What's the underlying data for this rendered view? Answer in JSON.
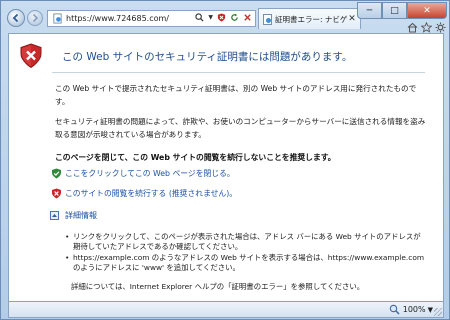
{
  "window": {
    "controls": {
      "minimize": "─",
      "maximize": "□",
      "close": "✕"
    }
  },
  "toolbar": {
    "back_icon": "back-arrow-icon",
    "forward_icon": "forward-arrow-icon",
    "address": {
      "url": "https://www.724685.com/",
      "tools": [
        "search-icon",
        "dropdown-icon",
        "certificate-error-icon",
        "refresh-icon",
        "stop-icon"
      ]
    },
    "tab": {
      "label": "証明書エラー: ナビゲーシ...",
      "close": "✕"
    },
    "right_icons": [
      "home-icon",
      "favorites-icon",
      "tools-icon"
    ]
  },
  "content": {
    "headline": "この Web サイトのセキュリティ証明書には問題があります。",
    "paragraph1": "この Web サイトで提示されたセキュリティ証明書は、別の Web サイトのアドレス用に発行されたものです。",
    "paragraph2": "セキュリティ証明書の問題によって、詐欺や、お使いのコンピューターからサーバーに送信される情報を盗み取る意図が示唆されている場合があります。",
    "recommendation": "このページを閉じて、この Web サイトの閲覧を続行しないことを推奨します。",
    "option_close": "ここをクリックしてこの Web ページを閉じる。",
    "option_continue": "このサイトの閲覧を続行する (推奨されません)。",
    "more_info": "詳細情報",
    "bullets": [
      "リンクをクリックして、このページが表示された場合は、アドレス バーにある Web サイトのアドレスが期待していたアドレスであるか確認してください。",
      "https://example.com のようなアドレスの Web サイトを表示する場合は、https://www.example.com のようにアドレスに 'www' を追加してください。"
    ],
    "footer": "詳細については、Internet Explorer ヘルプの「証明書のエラー」を参照してください。"
  },
  "statusbar": {
    "zoom": "100%",
    "zoom_caret": "▼"
  },
  "colors": {
    "link": "#1d52a3",
    "headline": "#1f4e8c",
    "shield_red": "#c62828",
    "shield_green": "#2e8b3a"
  }
}
